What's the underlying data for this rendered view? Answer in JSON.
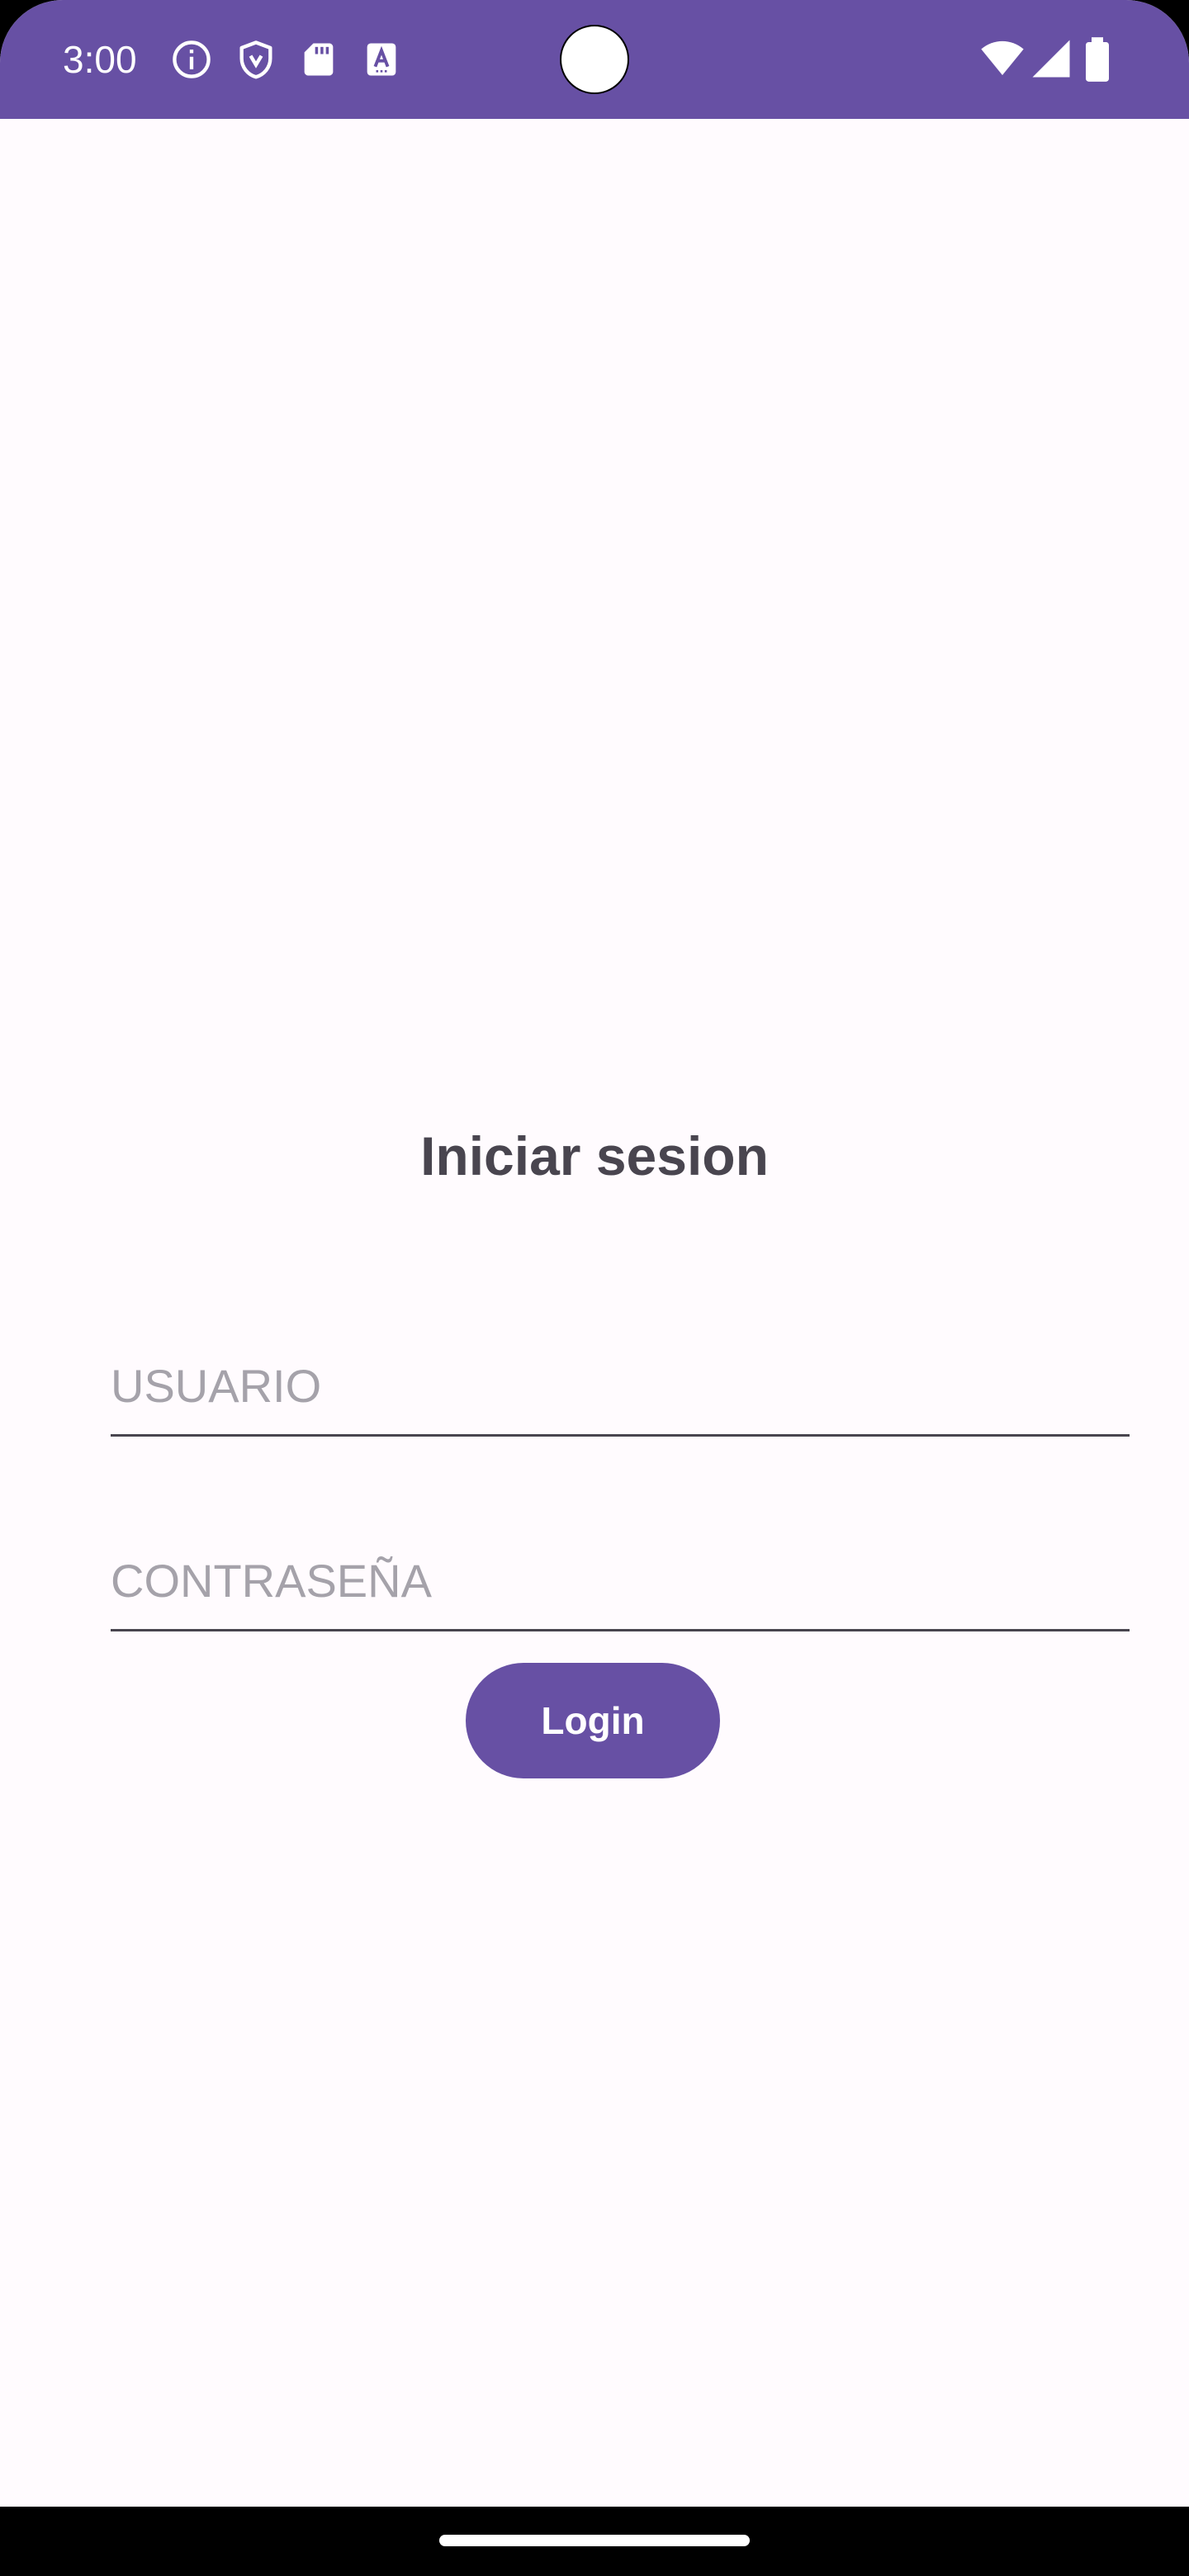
{
  "colors": {
    "primary": "#6750A4",
    "background": "#FFFBFE",
    "title_text": "#49454F",
    "placeholder_text": "#A5A2AA",
    "on_primary": "#FFFFFF"
  },
  "status_bar": {
    "time": "3:00",
    "left_icons": [
      "info-icon",
      "shield-icon",
      "sd-card-icon",
      "font-a-icon"
    ],
    "right_icons": [
      "wifi-icon",
      "signal-icon",
      "battery-icon"
    ]
  },
  "login": {
    "title": "Iniciar sesion",
    "username_placeholder": "USUARIO",
    "username_value": "",
    "password_placeholder": "CONTRASEÑA",
    "password_value": "",
    "button_label": "Login"
  }
}
